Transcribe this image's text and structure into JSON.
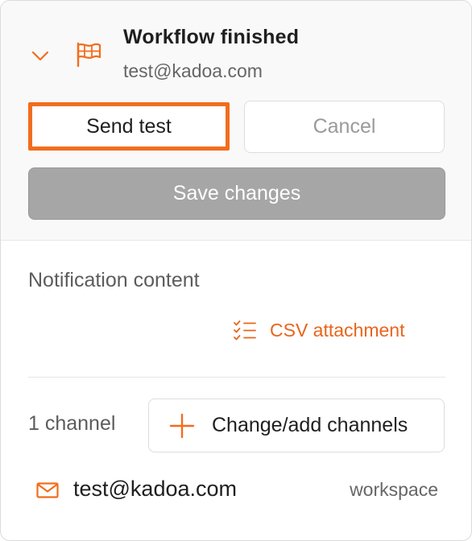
{
  "workflow": {
    "title": "Workflow finished",
    "subtitle": "test@kadoa.com",
    "icon": "flag-icon",
    "toggle_icon": "chevron-down-icon"
  },
  "actions": {
    "send_test_label": "Send test",
    "cancel_label": "Cancel",
    "save_label": "Save changes"
  },
  "content": {
    "section_label": "Notification content",
    "attachment_label": "CSV attachment",
    "attachment_icon": "checklist-icon"
  },
  "channels": {
    "count_label": "1 channel",
    "add_label": "Change/add channels",
    "add_icon": "plus-icon",
    "items": [
      {
        "icon": "mail-icon",
        "address": "test@kadoa.com",
        "tag": "workspace"
      }
    ]
  },
  "colors": {
    "accent": "#f26d1d",
    "accent_text": "#e8651c",
    "disabled_button": "#a6a6a6",
    "highlight_border": "#f26d1d"
  }
}
